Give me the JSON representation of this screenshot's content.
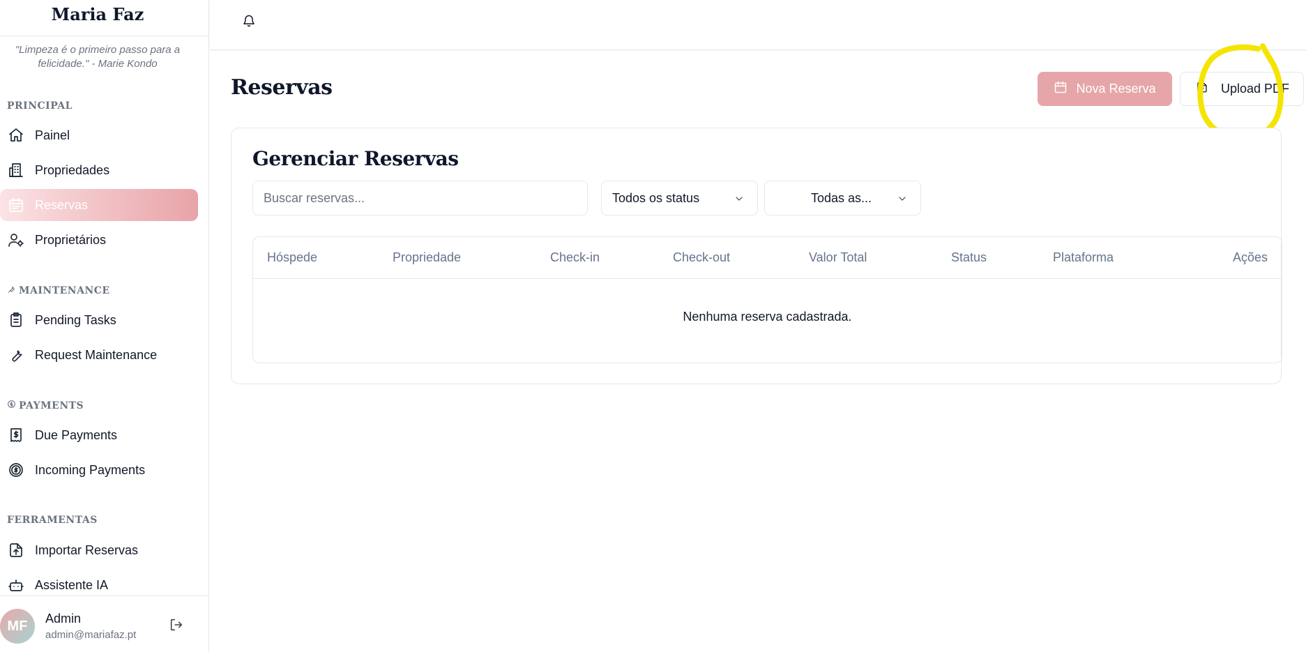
{
  "sidebar": {
    "brand": "Maria Faz",
    "quote": "\"Limpeza é o primeiro passo para a felicidade.\" - Marie Kondo",
    "sections": {
      "principal": "PRINCIPAL",
      "maintenance": "MAINTENANCE",
      "payments": "PAYMENTS",
      "tools": "FERRAMENTAS"
    },
    "items": {
      "painel": "Painel",
      "propriedades": "Propriedades",
      "reservas": "Reservas",
      "proprietarios": "Proprietários",
      "pending_tasks": "Pending Tasks",
      "request_maintenance": "Request Maintenance",
      "due_payments": "Due Payments",
      "incoming_payments": "Incoming Payments",
      "importar_reservas": "Importar Reservas",
      "assistente_ia": "Assistente IA"
    },
    "active_item": "reservas",
    "user": {
      "initials": "MF",
      "name": "Admin",
      "email": "admin@mariafaz.pt"
    }
  },
  "header": {
    "title": "Reservas",
    "new_button": "Nova Reserva",
    "upload_button": "Upload PDF"
  },
  "card": {
    "title": "Gerenciar Reservas",
    "search_placeholder": "Buscar reservas...",
    "status_filter": "Todos os status",
    "platform_filter": "Todas as...",
    "columns": [
      "Hóspede",
      "Propriedade",
      "Check-in",
      "Check-out",
      "Valor Total",
      "Status",
      "Plataforma",
      "Ações"
    ],
    "empty_message": "Nenhuma reserva cadastrada."
  },
  "colors": {
    "accent": "#e6a6a9",
    "highlight": "#f5e400"
  }
}
